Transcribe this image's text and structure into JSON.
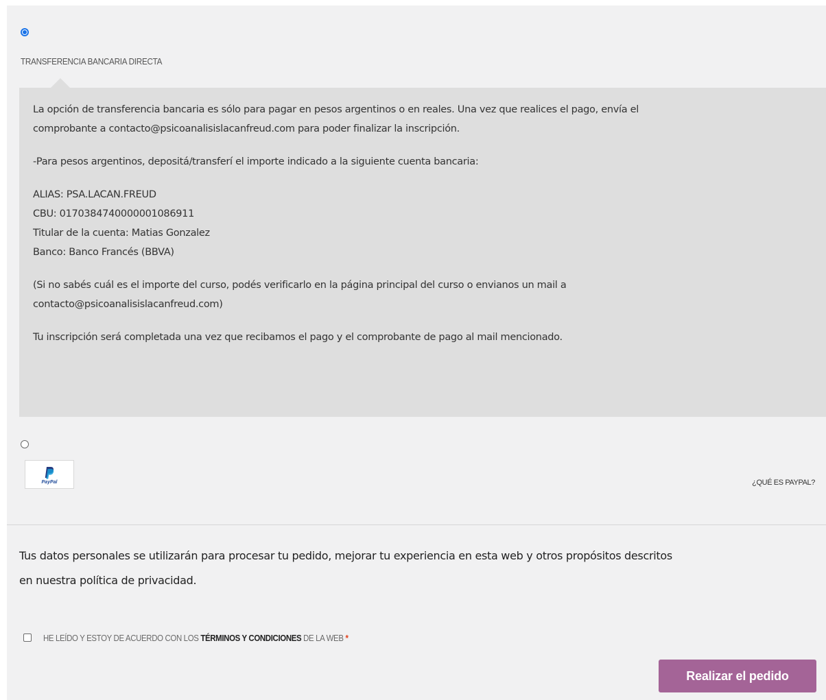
{
  "payment_methods": {
    "bank_transfer": {
      "label": "TRANSFERENCIA BANCARIA DIRECTA",
      "selected": true,
      "description": {
        "p1_line1": "La opción de transferencia bancaria es sólo para pagar en pesos argentinos o en reales. Una vez que realices el pago, envía el",
        "p1_line2": "comprobante a contacto@psicoanalisislacanfreud.com para poder finalizar la inscripción.",
        "p2": "-Para pesos argentinos, depositá/transferí el importe indicado a la siguiente cuenta bancaria:",
        "alias": "ALIAS: PSA.LACAN.FREUD",
        "cbu": "CBU: 0170384740000001086911",
        "holder": "Titular de la cuenta: Matias Gonzalez",
        "bank": "Banco: Banco Francés (BBVA)",
        "p4_line1": "(Si no sabés cuál es el importe del curso, podés verificarlo en la página principal del curso o envianos un mail a",
        "p4_line2": "contacto@psicoanalisislacanfreud.com)",
        "p5": "Tu inscripción será completada una vez que recibamos el pago y el comprobante de pago al mail mencionado."
      }
    },
    "paypal": {
      "selected": false,
      "logo_text": "PayPal",
      "what_is_link": "¿QUÉ ES PAYPAL?"
    }
  },
  "privacy": {
    "text_line1": "Tus datos personales se utilizarán para procesar tu pedido, mejorar tu experiencia en esta web y otros propósitos descritos",
    "text_line2": "en nuestra política de privacidad."
  },
  "terms": {
    "prefix": "HE LEÍDO Y ESTOY DE ACUERDO CON LOS ",
    "link": "TÉRMINOS Y CONDICIONES",
    "suffix": " DE LA WEB ",
    "required_mark": "*"
  },
  "submit": {
    "label": "Realizar el pedido"
  },
  "colors": {
    "panel_bg": "#f1f1f2",
    "description_bg": "#dedede",
    "button_bg": "#a46497",
    "radio_accent": "#1a73e8",
    "required": "#e2401c"
  },
  "icons": {
    "paypal": "paypal-logo-icon"
  }
}
